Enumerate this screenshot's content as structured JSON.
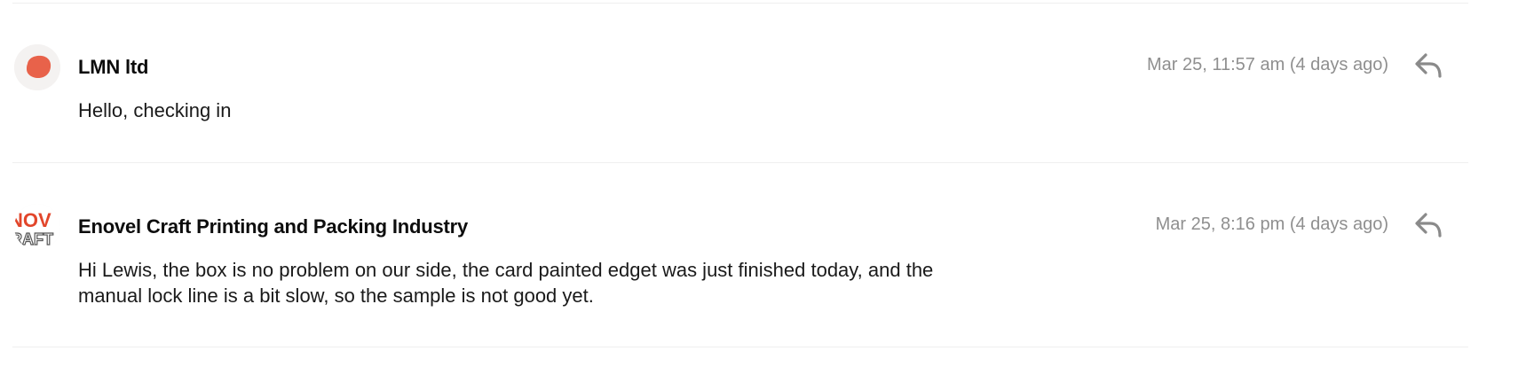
{
  "thread": {
    "messages": [
      {
        "sender": "LMN ltd",
        "timestamp": "Mar 25, 11:57 am (4 days ago)",
        "body": "Hello, checking in",
        "avatar_icon": "orange-blob-logo-icon",
        "avatar_color": "#E8624A"
      },
      {
        "sender": "Enovel Craft Printing and Packing Industry",
        "timestamp": "Mar 25, 8:16 pm (4 days ago)",
        "body": "Hi Lewis, the box is no problem on our side, the card painted edget was just finished today, and the manual lock line is a bit slow, so the sample is not good yet.",
        "avatar_icon": "enovel-craft-logo-icon",
        "avatar_color": "#E2462B"
      }
    ],
    "reply_icon": "reply-arrow-icon",
    "reply_icon_color": "#8a8a8a"
  }
}
